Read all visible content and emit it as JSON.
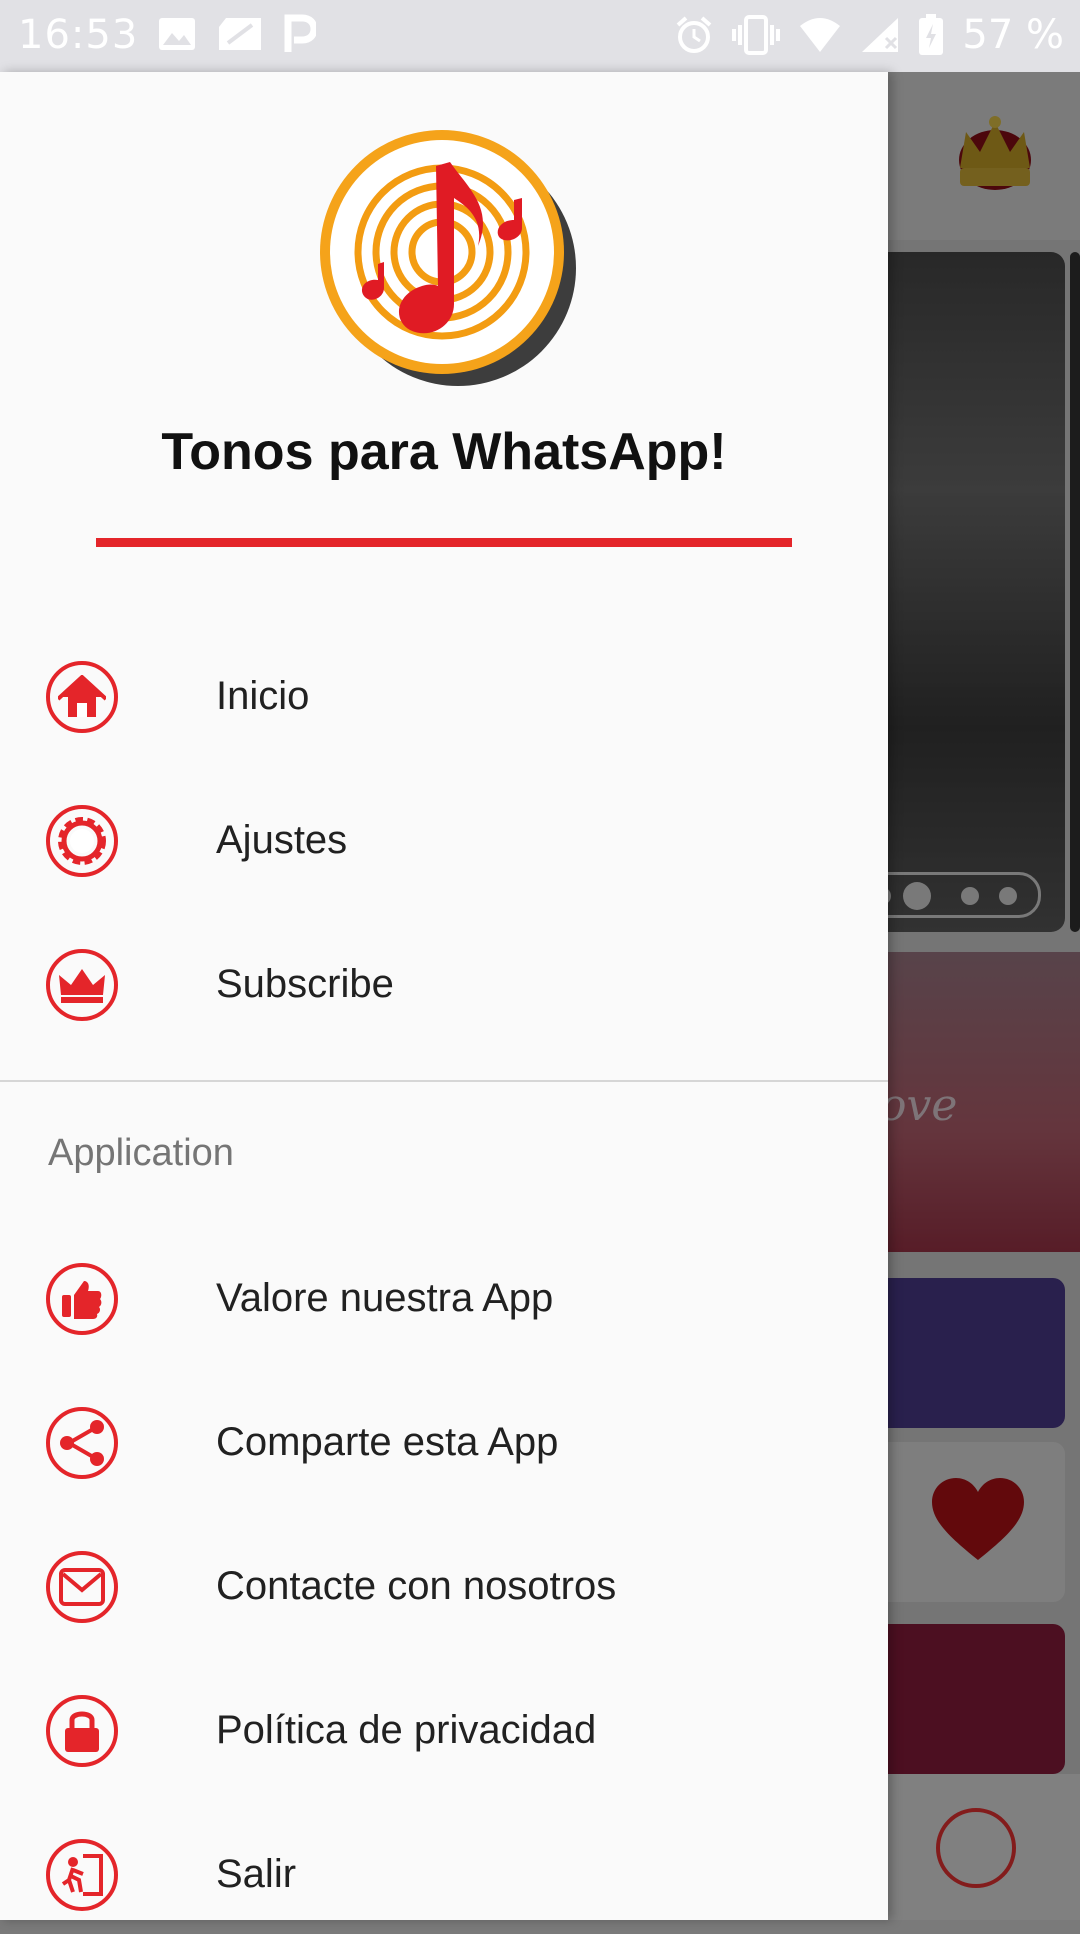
{
  "status_bar": {
    "time": "16:53",
    "left_icons": [
      "image-icon",
      "sd-card-icon",
      "p-letter-icon"
    ],
    "right_icons": [
      "alarm-icon",
      "vibrate-icon",
      "wifi-icon",
      "cell-signal-icon",
      "battery-icon"
    ],
    "battery_percent": "57 %"
  },
  "drawer": {
    "title": "Tonos para WhatsApp!",
    "accent_color": "#e4252a",
    "main_items": [
      {
        "label": "Inicio",
        "icon": "home-icon"
      },
      {
        "label": "Ajustes",
        "icon": "gear-icon"
      },
      {
        "label": "Subscribe",
        "icon": "crown-icon"
      }
    ],
    "section_header": "Application",
    "app_items": [
      {
        "label": "Valore nuestra App",
        "icon": "thumbs-up-icon"
      },
      {
        "label": "Comparte esta App",
        "icon": "share-icon"
      },
      {
        "label": "Contacte con nosotros",
        "icon": "mail-icon"
      },
      {
        "label": "Política de privacidad",
        "icon": "lock-icon"
      },
      {
        "label": "Salir",
        "icon": "exit-icon"
      }
    ]
  },
  "background": {
    "love_text": "ove"
  }
}
